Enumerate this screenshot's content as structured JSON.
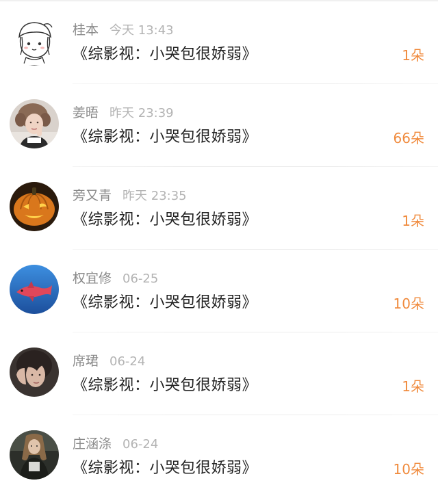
{
  "items": [
    {
      "user": "桂本",
      "time": "今天 13:43",
      "title": "《综影视：小哭包很娇弱》",
      "count": "1朵",
      "avatar_icon": "cartoon-girl-avatar"
    },
    {
      "user": "姜晤",
      "time": "昨天 23:39",
      "title": "《综影视：小哭包很娇弱》",
      "count": "66朵",
      "avatar_icon": "portrait-girl-avatar"
    },
    {
      "user": "旁又青",
      "time": "昨天 23:35",
      "title": "《综影视：小哭包很娇弱》",
      "count": "1朵",
      "avatar_icon": "pumpkin-avatar"
    },
    {
      "user": "权宜修",
      "time": "06-25",
      "title": "《综影视：小哭包很娇弱》",
      "count": "10朵",
      "avatar_icon": "fish-avatar"
    },
    {
      "user": "席珺",
      "time": "06-24",
      "title": "《综影视：小哭包很娇弱》",
      "count": "1朵",
      "avatar_icon": "portrait-boy-avatar"
    },
    {
      "user": "庄涵涤",
      "time": "06-24",
      "title": "《综影视：小哭包很娇弱》",
      "count": "10朵",
      "avatar_icon": "portrait-man-avatar"
    }
  ],
  "colors": {
    "accent": "#f08a3c",
    "username": "#8a8a8a",
    "time": "#b3b3b3",
    "title": "#222222"
  }
}
